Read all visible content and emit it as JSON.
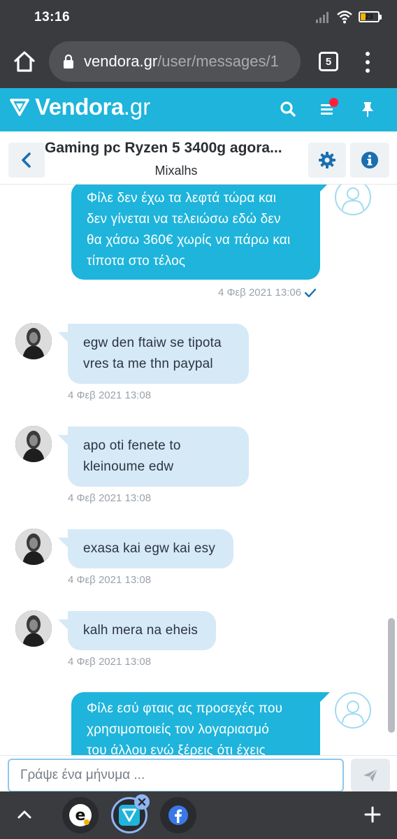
{
  "status_bar": {
    "time": "13:16",
    "battery_level": "23"
  },
  "browser": {
    "url_host": "vendora.gr",
    "url_path": "/user/messages/1",
    "tab_count": "5"
  },
  "site": {
    "logo_name": "Vendora",
    "logo_tld": ".gr"
  },
  "conversation": {
    "title": "Gaming pc Ryzen 5 3400g agora...",
    "user": "Mixalhs"
  },
  "messages": [
    {
      "direction": "out",
      "lines": [
        "Φίλε δεν έχω τα λεφτά τώρα και",
        "δεν γίνεται να τελειώσω εδώ δεν",
        "θα χάσω 360€ χωρίς να πάρω και",
        "τίποτα στο τέλος"
      ],
      "time": "4 Φεβ 2021 13:06"
    },
    {
      "direction": "in",
      "lines": [
        "egw den ftaiw se tipota",
        "vres ta me thn paypal"
      ],
      "time": "4 Φεβ 2021 13:08"
    },
    {
      "direction": "in",
      "lines": [
        "apo oti fenete to",
        "kleinoume edw"
      ],
      "time": "4 Φεβ 2021 13:08"
    },
    {
      "direction": "in",
      "lines": [
        "exasa kai egw kai esy"
      ],
      "time": "4 Φεβ 2021 13:08"
    },
    {
      "direction": "in",
      "lines": [
        "kalh mera na eheis"
      ],
      "time": "4 Φεβ 2021 13:08"
    },
    {
      "direction": "out",
      "lines": [
        "Φίλε εσύ φταις ας προσεχές που",
        "χρησιμοποιείς τον λογαριασμό",
        "του άλλου ενώ ξέρεις ότι έχεις"
      ],
      "time": ""
    }
  ],
  "composer": {
    "placeholder": "Γράψε ένα μήνυμα ..."
  },
  "tab_strip": {
    "tabs": [
      "ecommerce-tab",
      "vendora-tab",
      "facebook-tab"
    ]
  },
  "colors": {
    "brand": "#1eb4db",
    "incoming_bubble": "#d6e9f7",
    "chrome": "#3a3b3e"
  }
}
